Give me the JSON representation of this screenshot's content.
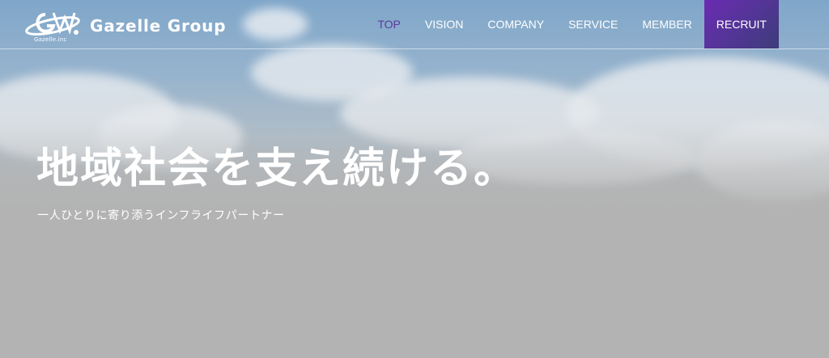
{
  "brand": {
    "name": "Gazelle Group",
    "logo_subtext": "Gazelle.inc"
  },
  "nav": {
    "items": [
      {
        "label": "TOP",
        "active": true
      },
      {
        "label": "VISION",
        "active": false
      },
      {
        "label": "COMPANY",
        "active": false
      },
      {
        "label": "SERVICE",
        "active": false
      },
      {
        "label": "MEMBER",
        "active": false
      },
      {
        "label": "RECRUIT",
        "active": false
      }
    ]
  },
  "hero": {
    "headline": "地域社会を支え続ける。",
    "tagline": "一人ひとりに寄り添うインフライフパートナー"
  },
  "colors": {
    "accent": "#5a3a9e",
    "recruit_bg_start": "#6a2cb3",
    "recruit_bg_end": "#3d3d7a",
    "sky": "#7fa6c9",
    "base_gray": "#b3b3b3"
  }
}
